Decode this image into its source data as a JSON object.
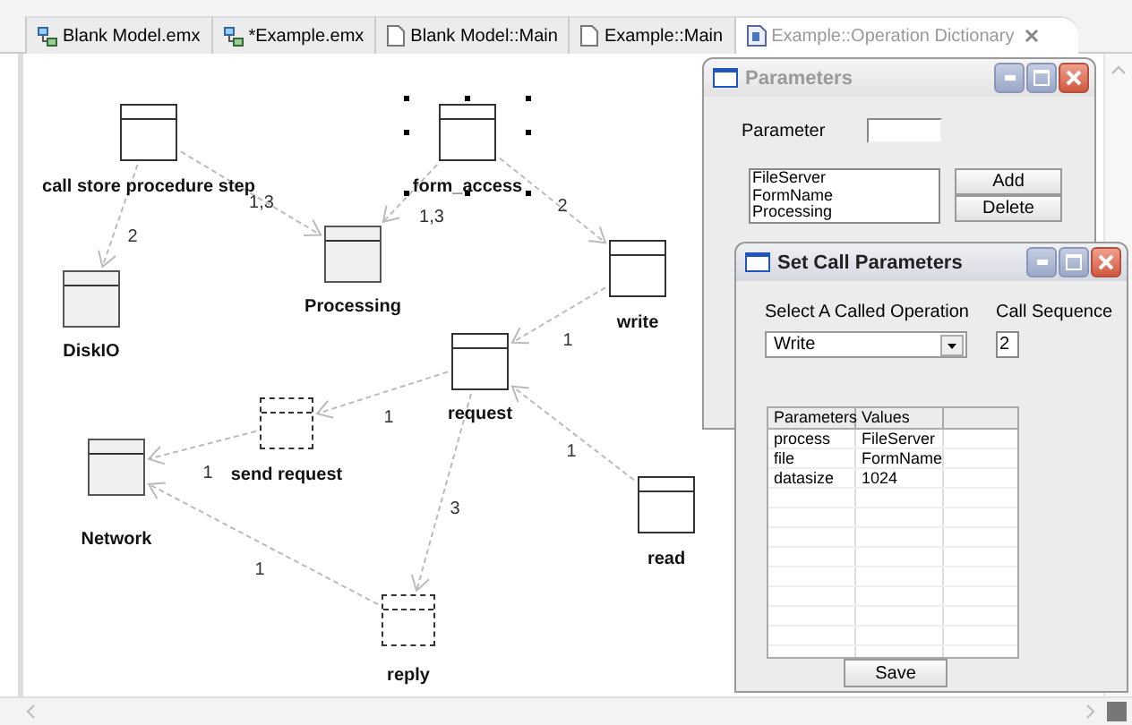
{
  "tabs": [
    {
      "label": "Blank Model.emx",
      "kind": "model",
      "selected": false
    },
    {
      "label": "*Example.emx",
      "kind": "model",
      "selected": false
    },
    {
      "label": "Blank Model::Main",
      "kind": "page",
      "selected": false
    },
    {
      "label": "Example::Main",
      "kind": "page",
      "selected": false
    },
    {
      "label": "Example::Operation Dictionary",
      "kind": "dictionary",
      "selected": true
    }
  ],
  "diagram": {
    "nodes": [
      {
        "label": "call store procedure step",
        "kind": "plain",
        "selected": false
      },
      {
        "label": "form_access",
        "kind": "plain",
        "selected": true
      },
      {
        "label": "Processing",
        "kind": "filled",
        "selected": false
      },
      {
        "label": "DiskIO",
        "kind": "filled",
        "selected": false
      },
      {
        "label": "write",
        "kind": "plain",
        "selected": false
      },
      {
        "label": "request",
        "kind": "plain",
        "selected": false
      },
      {
        "label": "send request",
        "kind": "dashed",
        "selected": false
      },
      {
        "label": "Network",
        "kind": "filled",
        "selected": false
      },
      {
        "label": "read",
        "kind": "plain",
        "selected": false
      },
      {
        "label": "reply",
        "kind": "dashed",
        "selected": false
      }
    ],
    "edges": [
      {
        "label": "1,3"
      },
      {
        "label": "2"
      },
      {
        "label": "1,3"
      },
      {
        "label": "2"
      },
      {
        "label": "1"
      },
      {
        "label": "1"
      },
      {
        "label": "1"
      },
      {
        "label": "1"
      },
      {
        "label": "3"
      },
      {
        "label": "1"
      }
    ]
  },
  "parameters_window": {
    "title": "Parameters",
    "active": false,
    "parameter_label": "Parameter",
    "list_items": [
      "FileServer",
      "FormName",
      "Processing"
    ],
    "buttons": [
      "Add",
      "Delete"
    ]
  },
  "call_window": {
    "title": "Set Call Parameters",
    "active": true,
    "operation_label": "Select A Called Operation",
    "operation_value": "Write",
    "sequence_label": "Call Sequence",
    "sequence_value": "2",
    "table": {
      "columns": [
        "Parameters",
        "Values"
      ],
      "rows": [
        [
          "process",
          "FileServer"
        ],
        [
          "file",
          "FormName"
        ],
        [
          "datasize",
          "1024"
        ]
      ]
    },
    "save_button": "Save"
  }
}
